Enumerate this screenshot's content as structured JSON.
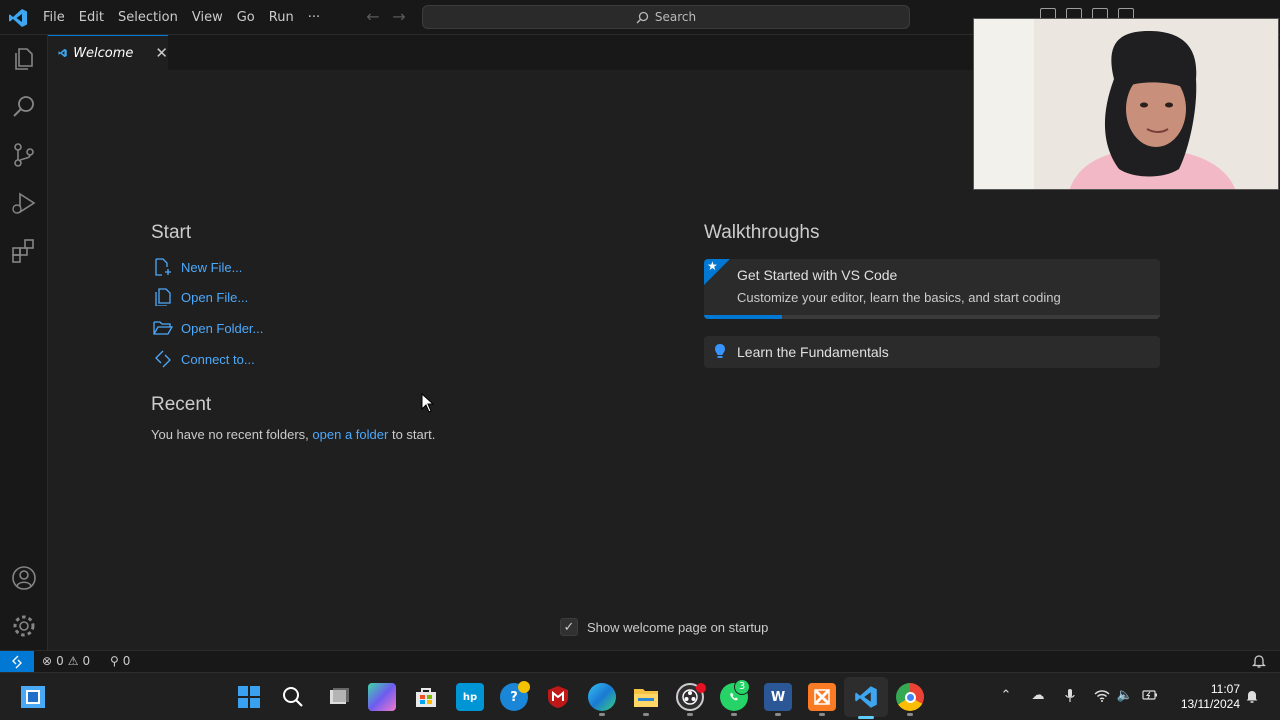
{
  "menu": [
    "File",
    "Edit",
    "Selection",
    "View",
    "Go",
    "Run",
    "···"
  ],
  "search": {
    "label": "Search"
  },
  "tab": {
    "label": "Welcome"
  },
  "start": {
    "heading": "Start",
    "items": [
      "New File...",
      "Open File...",
      "Open Folder...",
      "Connect to..."
    ]
  },
  "recent": {
    "heading": "Recent",
    "text_before": "You have no recent folders,",
    "link": "open a folder",
    "text_after": "to start."
  },
  "walkthroughs": {
    "heading": "Walkthroughs",
    "items": [
      {
        "title": "Get Started with VS Code",
        "description": "Customize your editor, learn the basics, and start coding",
        "icon": "star-icon",
        "progress": 0.17
      },
      {
        "title": "Learn the Fundamentals",
        "icon": "lightbulb-icon"
      }
    ]
  },
  "startup_checkbox": {
    "label": "Show welcome page on startup",
    "checked": true
  },
  "statusbar": {
    "errors": "0",
    "warnings": "0",
    "ports": "0"
  },
  "taskbar": {
    "time": "11:07",
    "date": "13/11/2024",
    "whatsapp_badge": "3",
    "apps": [
      "start",
      "search",
      "task-view",
      "copilot",
      "microsoft-store",
      "myhp",
      "get-help",
      "mcafee",
      "edge",
      "file-explorer",
      "obs",
      "whatsapp",
      "word",
      "xampp",
      "vscode",
      "chrome"
    ]
  },
  "colors": {
    "accent": "#0078d4",
    "link": "#4daafc",
    "background": "#1f1f1f",
    "chrome": "#181818"
  }
}
